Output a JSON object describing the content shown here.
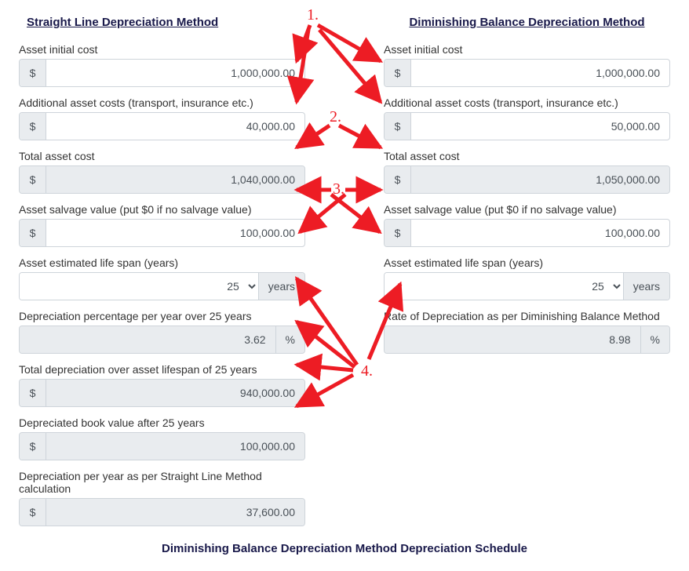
{
  "left": {
    "title": "Straight Line Depreciation Method",
    "fields": {
      "initialCost": {
        "label": "Asset initial cost",
        "value": "1,000,000.00"
      },
      "additionalCosts": {
        "label": "Additional asset costs (transport, insurance etc.)",
        "value": "40,000.00"
      },
      "totalCost": {
        "label": "Total asset cost",
        "value": "1,040,000.00"
      },
      "salvage": {
        "label": "Asset salvage value (put $0 if no salvage value)",
        "value": "100,000.00"
      },
      "lifespan": {
        "label": "Asset estimated life span (years)",
        "value": "25",
        "unit": "years"
      },
      "depPct": {
        "label": "Depreciation percentage per year over 25 years",
        "value": "3.62"
      },
      "totalDep": {
        "label": "Total depreciation over asset lifespan of 25 years",
        "value": "940,000.00"
      },
      "bookValue": {
        "label": "Depreciated book value after 25 years",
        "value": "100,000.00"
      },
      "depPerYear": {
        "label": "Depreciation per year as per Straight Line Method calculation",
        "value": "37,600.00"
      }
    }
  },
  "right": {
    "title": "Diminishing Balance Depreciation Method",
    "fields": {
      "initialCost": {
        "label": "Asset initial cost",
        "value": "1,000,000.00"
      },
      "additionalCosts": {
        "label": "Additional asset costs (transport, insurance etc.)",
        "value": "50,000.00"
      },
      "totalCost": {
        "label": "Total asset cost",
        "value": "1,050,000.00"
      },
      "salvage": {
        "label": "Asset salvage value (put $0 if no salvage value)",
        "value": "100,000.00"
      },
      "lifespan": {
        "label": "Asset estimated life span (years)",
        "value": "25",
        "unit": "years"
      },
      "rate": {
        "label": "Rate of Depreciation as per Diminishing Balance Method",
        "value": "8.98"
      }
    }
  },
  "symbols": {
    "currency": "$",
    "percent": "%"
  },
  "annotations": {
    "n1": "1.",
    "n2": "2.",
    "n3": "3.",
    "n4": "4."
  },
  "bottomHeading": "Diminishing Balance Depreciation Method Depreciation Schedule"
}
